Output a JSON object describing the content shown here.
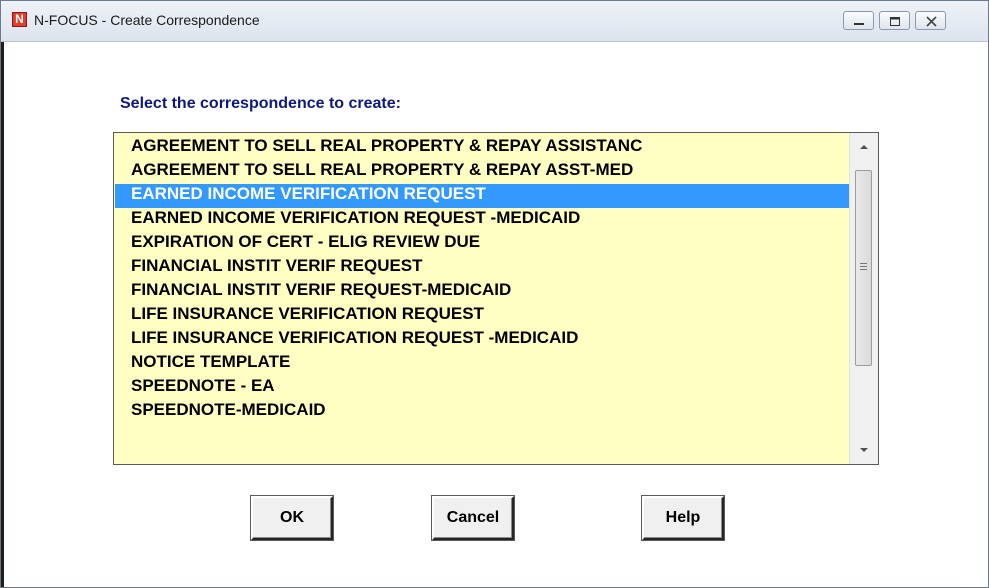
{
  "window": {
    "title": "N-FOCUS - Create Correspondence",
    "app_icon_letter": "N"
  },
  "dialog": {
    "prompt": "Select the correspondence to create:",
    "selected_index": 2,
    "items": [
      "AGREEMENT TO SELL REAL PROPERTY & REPAY ASSISTANC",
      "AGREEMENT TO SELL REAL PROPERTY & REPAY ASST-MED",
      "EARNED INCOME VERIFICATION REQUEST",
      "EARNED INCOME VERIFICATION REQUEST -MEDICAID",
      "EXPIRATION OF CERT - ELIG REVIEW DUE",
      "FINANCIAL INSTIT VERIF REQUEST",
      "FINANCIAL INSTIT VERIF REQUEST-MEDICAID",
      "LIFE INSURANCE VERIFICATION REQUEST",
      "LIFE INSURANCE VERIFICATION REQUEST -MEDICAID",
      "NOTICE TEMPLATE",
      "SPEEDNOTE - EA",
      "SPEEDNOTE-MEDICAID"
    ]
  },
  "buttons": {
    "ok": "OK",
    "cancel": "Cancel",
    "help": "Help"
  },
  "colors": {
    "list_background": "#ffffc4",
    "selection": "#3399ff",
    "prompt_text": "#0d1a7c"
  }
}
